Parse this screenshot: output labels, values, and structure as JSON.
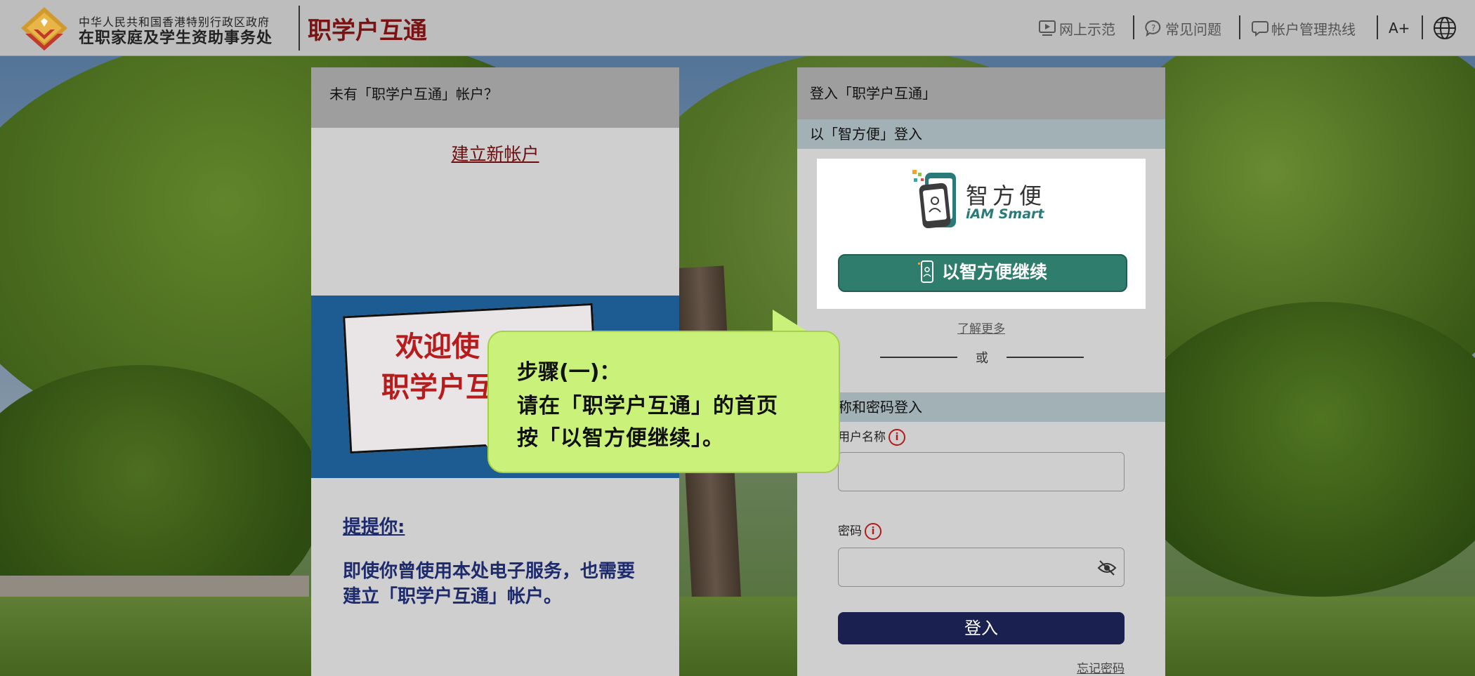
{
  "header": {
    "org_line1": "中华人民共和国香港特别行政区政府",
    "org_line2": "在职家庭及学生资助事务处",
    "app_title": "职学户互通",
    "nav": {
      "demo": "网上示范",
      "faq": "常见问题",
      "hotline": "帐户管理热线",
      "font_size": "A+"
    }
  },
  "left_panel": {
    "heading": "未有「职学户互通」帐户？",
    "create_link": "建立新帐户",
    "banner_line1": "欢迎使",
    "banner_line2": "职学户互",
    "reminder_title": "提提你:",
    "reminder_body": "即使你曾使用本处电子服务，也需要建立「职学户互通」帐户。"
  },
  "right_panel": {
    "heading": "登入「职学户互通」",
    "iamsmart_section": "以「智方便」登入",
    "iamsmart_logo_cn": "智方便",
    "iamsmart_logo_en": "iAM Smart",
    "iamsmart_button": "以智方便继续",
    "learn_more": "了解更多",
    "or": "或",
    "password_section": "户名称和密码登入",
    "username_label": "用户名称",
    "password_label": "密码",
    "username_value": "",
    "password_value": "",
    "login_button": "登入",
    "forgot_password": "忘记密码"
  },
  "callout": {
    "title": "步骤(一)：",
    "line1": "请在「职学户互通」的首页",
    "line2": "按「以智方便继续」。"
  },
  "colors": {
    "title_red": "#7a1414",
    "iamsmart_green": "#2f7d6c",
    "login_navy": "#1a2150",
    "callout_green": "#caf27a"
  }
}
